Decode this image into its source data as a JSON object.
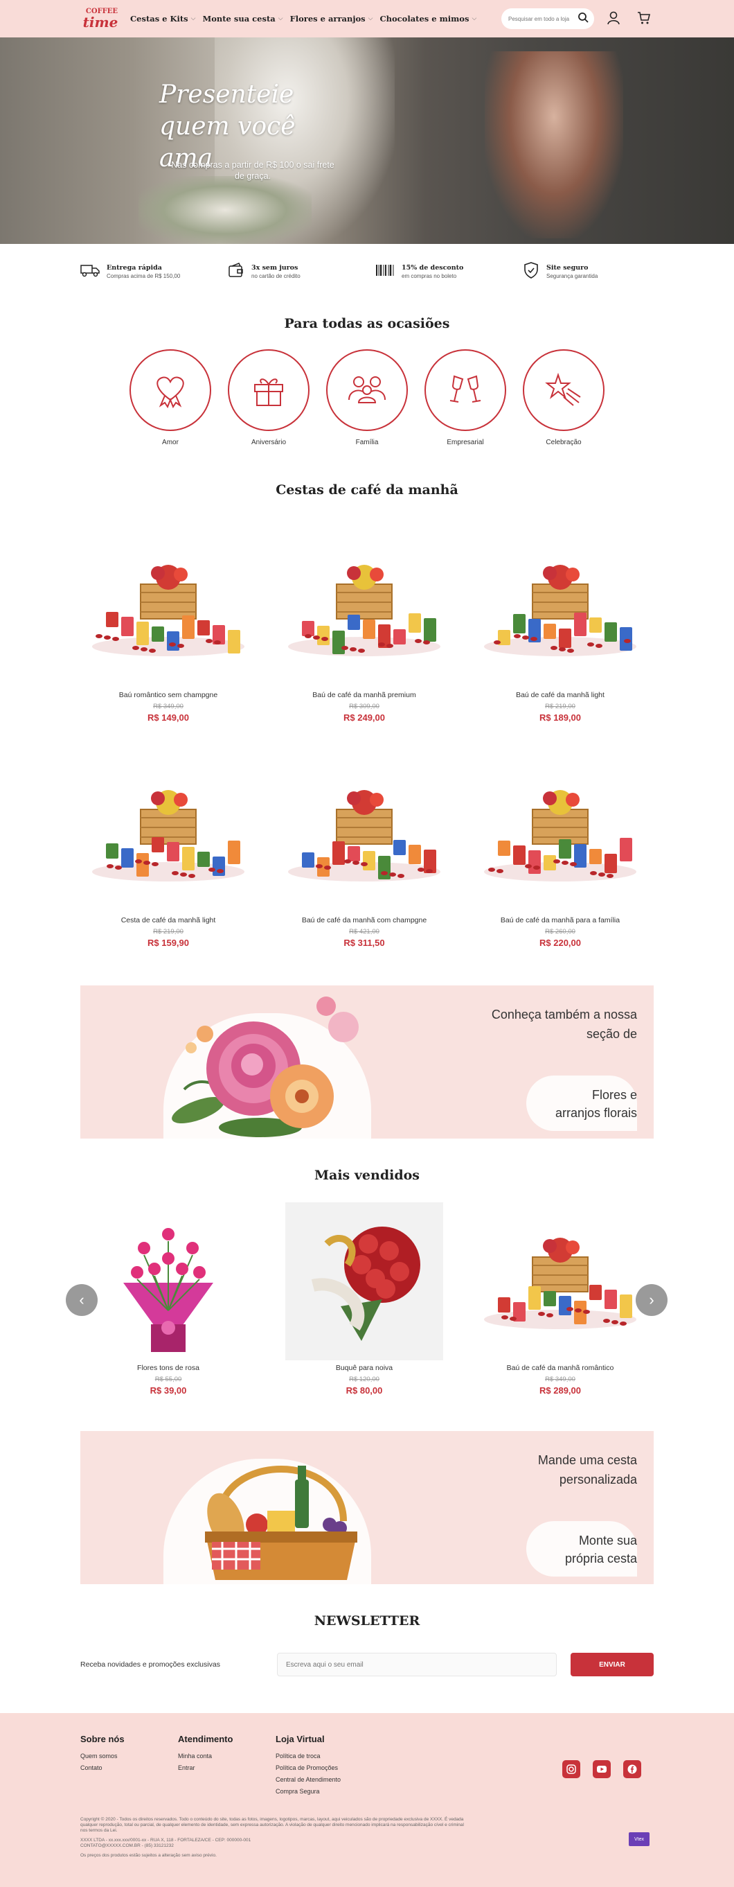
{
  "header": {
    "logo_top": "COFFEE",
    "logo_bottom": "time",
    "nav": [
      "Cestas e Kits",
      "Monte sua cesta",
      "Flores e arranjos",
      "Chocolates e mimos"
    ],
    "search_placeholder": "Pesquisar em todo a loja"
  },
  "hero": {
    "title": "Presenteie quem você ama",
    "subtitle": "Nas compras a partir de R$ 100 o sai frete de graça."
  },
  "benefits": [
    {
      "title": "Entrega rápida",
      "sub": "Compras acima de R$ 150,00",
      "icon": "truck-icon"
    },
    {
      "title": "3x sem juros",
      "sub": "no cartão de crédito",
      "icon": "wallet-icon"
    },
    {
      "title": "15% de desconto",
      "sub": "em compras no boleto",
      "icon": "barcode-icon"
    },
    {
      "title": "Site seguro",
      "sub": "Segurança garantida",
      "icon": "shield-icon"
    }
  ],
  "occasions": {
    "title": "Para todas as ocasiões",
    "items": [
      "Amor",
      "Aniversário",
      "Família",
      "Empresarial",
      "Celebração"
    ]
  },
  "breakfast": {
    "title": "Cestas de café da manhã",
    "products": [
      {
        "name": "Baú romântico sem champgne",
        "old": "R$ 349,00",
        "price": "R$ 149,00"
      },
      {
        "name": "Baú de café da manhã premium",
        "old": "R$ 309,00",
        "price": "R$ 249,00"
      },
      {
        "name": "Baú de café da manhã light",
        "old": "R$ 219,00",
        "price": "R$ 189,00"
      },
      {
        "name": "Cesta de café da manhã light",
        "old": "R$ 219,00",
        "price": "R$ 159,90"
      },
      {
        "name": "Baú de café da manhã com champgne",
        "old": "R$ 421,00",
        "price": "R$ 311,50"
      },
      {
        "name": "Baú de café da manhã para a família",
        "old": "R$ 260,00",
        "price": "R$ 220,00"
      }
    ]
  },
  "flowers_banner": {
    "line1": "Conheça também a nossa",
    "line2": "seção de",
    "line3": "Flores e",
    "line4": "arranjos florais"
  },
  "bestsellers": {
    "title": "Mais vendidos",
    "products": [
      {
        "name": "Flores tons de rosa",
        "old": "R$ 55,00",
        "price": "R$ 39,00"
      },
      {
        "name": "Buquê para noiva",
        "old": "R$ 120,00",
        "price": "R$ 80,00"
      },
      {
        "name": "Baú de café da manhã romântico",
        "old": "R$ 349,00",
        "price": "R$ 289,00"
      }
    ]
  },
  "custom_banner": {
    "line1": "Mande uma cesta",
    "line2": "personalizada",
    "line3": "Monte sua",
    "line4": "própria cesta"
  },
  "newsletter": {
    "title": "NEWSLETTER",
    "label": "Receba novidades e promoções exclusivas",
    "placeholder": "Escreva aqui o seu email",
    "button": "ENVIAR"
  },
  "footer": {
    "col1": {
      "title": "Sobre nós",
      "links": [
        "Quem somos",
        "Contato"
      ]
    },
    "col2": {
      "title": "Atendimento",
      "links": [
        "Minha conta",
        "Entrar"
      ]
    },
    "col3": {
      "title": "Loja Virtual",
      "links": [
        "Política de troca",
        "Política de Promoções",
        "Central de Atendimento",
        "Compra Segura"
      ]
    },
    "legal1": "Copyright © 2020 - Todos os direitos reservados. Todo o conteúdo do site, todas as fotos, imagens, logotipos, marcas, layout, aqui veiculados são de propriedade exclusiva de XXXX. É vedada qualquer reprodução, total ou parcial, de qualquer elemento de identidade, sem expressa autorização. A violação de qualquer direito mencionado implicará na responsabilização cível e criminal nos termos da Lei.",
    "legal2": "XXXX LTDA - xx.xxx.xxx/0001-xx - RUA X, 118 - FORTALEZA/CE - CEP: 000000-001",
    "legal3": "CONTATO@XXXXX.COM.BR - (85) 33121232",
    "legal4": "Os preços dos produtos estão sujeitos a alteração sem aviso prévio.",
    "badge": "Vtex"
  },
  "colors": {
    "brand": "#c8323a",
    "header_bg": "#f9dcd8",
    "banner_bg": "#f9e2df"
  }
}
